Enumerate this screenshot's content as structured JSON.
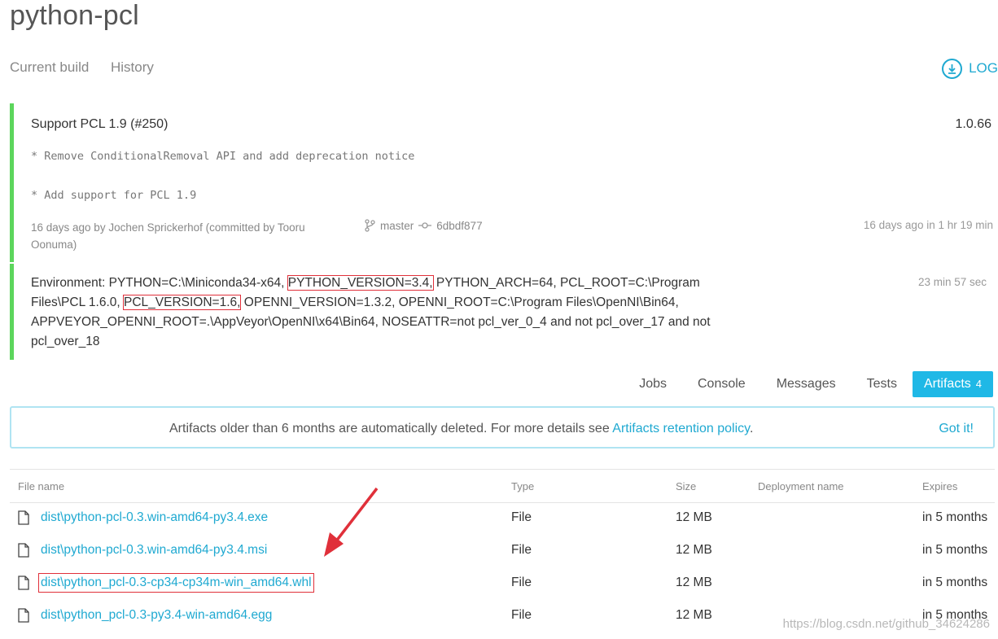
{
  "project": {
    "title": "python-pcl"
  },
  "nav": {
    "current_build": "Current build",
    "history": "History",
    "log": "LOG"
  },
  "build": {
    "commit_title": "Support PCL 1.9 (#250)",
    "version": "1.0.66",
    "message_lines": [
      "* Remove ConditionalRemoval API and add deprecation notice",
      "* Add support for PCL 1.9"
    ],
    "author_line": "16 days ago by Jochen Sprickerhof (committed by Tooru Oonuma)",
    "branch": "master",
    "commit": "6dbdf877",
    "duration": "16 days ago in 1 hr 19 min"
  },
  "environment": {
    "p1": "Environment: PYTHON=C:\\Miniconda34-x64, ",
    "p2": "PYTHON_VERSION=3.4,",
    "p3": " PYTHON_ARCH=64, PCL_ROOT=C:\\Program Files\\PCL 1.6.0, ",
    "p4": "PCL_VERSION=1.6,",
    "p5": " OPENNI_VERSION=1.3.2, OPENNI_ROOT=C:\\Program Files\\OpenNI\\Bin64, APPVEYOR_OPENNI_ROOT=.\\AppVeyor\\OpenNI\\x64\\Bin64, NOSEATTR=not pcl_ver_0_4 and not pcl_over_17 and not pcl_over_18",
    "elapsed": "23 min 57 sec"
  },
  "tabs": {
    "jobs": "Jobs",
    "console": "Console",
    "messages": "Messages",
    "tests": "Tests",
    "artifacts": "Artifacts",
    "artifacts_count": "4"
  },
  "notice": {
    "text": "Artifacts older than 6 months are automatically deleted. For more details see ",
    "link": "Artifacts retention policy",
    "end": ".",
    "got_it": "Got it!"
  },
  "table": {
    "headers": {
      "file_name": "File name",
      "type": "Type",
      "size": "Size",
      "deployment": "Deployment name",
      "expires": "Expires"
    },
    "rows": [
      {
        "name": "dist\\python-pcl-0.3.win-amd64-py3.4.exe",
        "type": "File",
        "size": "12 MB",
        "expires": "in 5 months"
      },
      {
        "name": "dist\\python-pcl-0.3.win-amd64-py3.4.msi",
        "type": "File",
        "size": "12 MB",
        "expires": "in 5 months"
      },
      {
        "name": "dist\\python_pcl-0.3-cp34-cp34m-win_amd64.whl",
        "type": "File",
        "size": "12 MB",
        "expires": "in 5 months"
      },
      {
        "name": "dist\\python_pcl-0.3-py3.4-win-amd64.egg",
        "type": "File",
        "size": "12 MB",
        "expires": "in 5 months"
      }
    ]
  },
  "watermark": "https://blog.csdn.net/github_34624286",
  "colors": {
    "accent": "#1fa9d1",
    "success": "#5cd65c",
    "highlight": "#e0303a"
  }
}
